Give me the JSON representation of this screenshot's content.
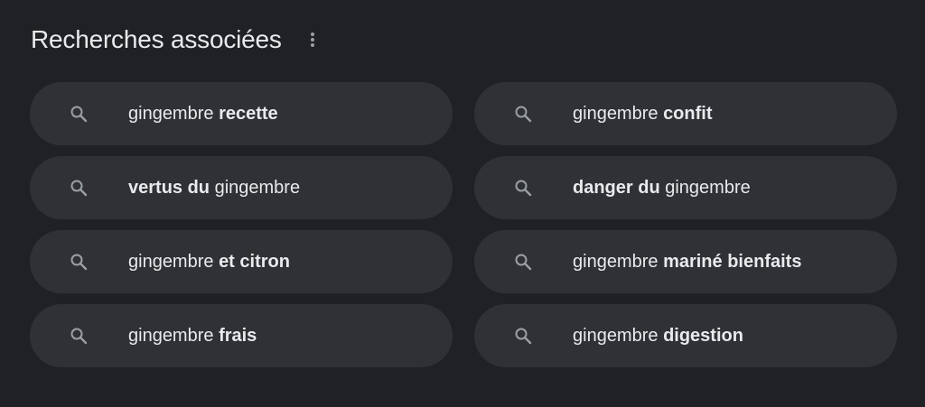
{
  "section": {
    "title": "Recherches associées",
    "menu_icon": "more-vert-icon"
  },
  "searches": [
    {
      "parts": [
        {
          "text": "gingembre ",
          "bold": false
        },
        {
          "text": "recette",
          "bold": true
        }
      ]
    },
    {
      "parts": [
        {
          "text": "gingembre ",
          "bold": false
        },
        {
          "text": "confit",
          "bold": true
        }
      ]
    },
    {
      "parts": [
        {
          "text": "vertus du",
          "bold": true
        },
        {
          "text": " gingembre",
          "bold": false
        }
      ]
    },
    {
      "parts": [
        {
          "text": "danger du",
          "bold": true
        },
        {
          "text": " gingembre",
          "bold": false
        }
      ]
    },
    {
      "parts": [
        {
          "text": "gingembre ",
          "bold": false
        },
        {
          "text": "et citron",
          "bold": true
        }
      ]
    },
    {
      "parts": [
        {
          "text": "gingembre ",
          "bold": false
        },
        {
          "text": "mariné bienfaits",
          "bold": true
        }
      ]
    },
    {
      "parts": [
        {
          "text": "gingembre ",
          "bold": false
        },
        {
          "text": "frais",
          "bold": true
        }
      ]
    },
    {
      "parts": [
        {
          "text": "gingembre ",
          "bold": false
        },
        {
          "text": "digestion",
          "bold": true
        }
      ]
    }
  ],
  "chip_icon": "search-icon",
  "colors": {
    "background": "#202124",
    "chip": "#303134",
    "text": "#e8eaed",
    "icon": "#9aa0a6"
  }
}
